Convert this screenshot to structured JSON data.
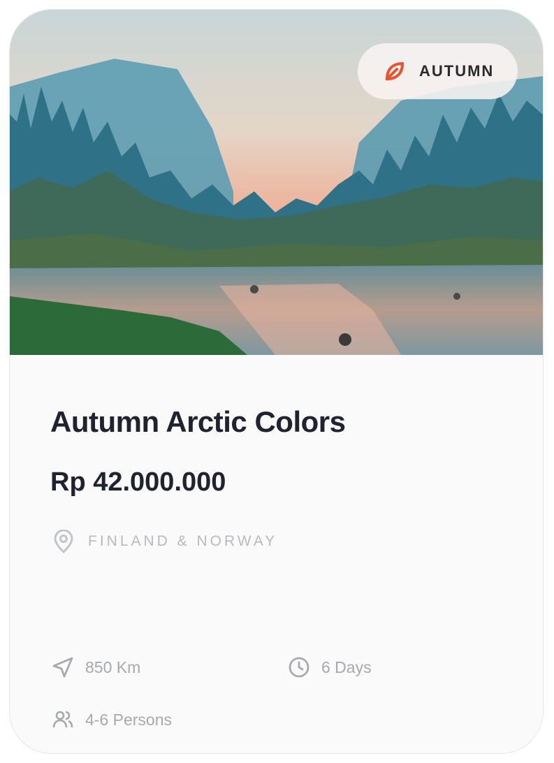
{
  "card": {
    "badge": {
      "label": "AUTUMN",
      "icon": "leaf-icon",
      "accent": "#e8542f"
    },
    "image": {
      "description_icon": "landscape-image"
    },
    "title": "Autumn Arctic Colors",
    "price": "Rp 42.000.000",
    "location": {
      "icon": "map-pin-icon",
      "label": "FINLAND & NORWAY"
    },
    "stats": {
      "distance": {
        "icon": "navigation-icon",
        "label": "850 Km"
      },
      "duration": {
        "icon": "clock-icon",
        "label": "6 Days"
      },
      "persons": {
        "icon": "users-icon",
        "label": "4-6 Persons"
      }
    }
  }
}
